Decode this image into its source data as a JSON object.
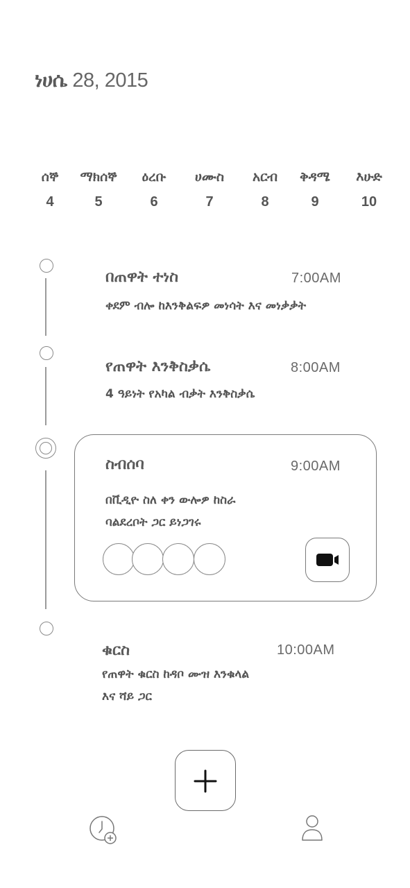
{
  "header": {
    "month": "ነሀሴ",
    "date_rest": " 28, 2015"
  },
  "week": [
    {
      "name": "ሰኞ",
      "num": "4"
    },
    {
      "name": "ማክሰኞ",
      "num": "5"
    },
    {
      "name": "ዕረቡ",
      "num": "6"
    },
    {
      "name": "ሀሙስ",
      "num": "7"
    },
    {
      "name": "አርብ",
      "num": "8"
    },
    {
      "name": "ቅዳሜ",
      "num": "9"
    },
    {
      "name": "እሁድ",
      "num": "10"
    }
  ],
  "events": [
    {
      "title": "በጠዋት ተነስ",
      "time": "7:00AM",
      "desc": [
        "ቀደም ብሎ ከእንቅልፍዎ መነሳት እና መነቃቃት"
      ]
    },
    {
      "title": "የጠዋት እንቅስቃሴ",
      "time": "8:00AM",
      "desc": [
        "4 ዓይነት የአካል ብቃት እንቅስቃሴ"
      ]
    },
    {
      "title": "ስብሰባ",
      "time": "9:00AM",
      "desc": [
        "በቪዲዮ ስለ ቀን ውሎዎ ከስራ",
        "ባልደረቦት ጋር ይነጋገሩ"
      ]
    },
    {
      "title": "ቁርስ",
      "time": "10:00AM",
      "desc": [
        "የጠዋት ቁርስ ከዳቦ ሙዝ እንቁላል",
        "እና ሻይ ጋር"
      ]
    }
  ],
  "icons": {
    "video": "video-camera-icon",
    "add": "plus-icon",
    "nav_left": "clock-add-icon",
    "nav_right": "user-icon"
  },
  "colors": {
    "stroke": "#7a7a7a",
    "text": "#555555",
    "icon_fill": "#111111"
  }
}
